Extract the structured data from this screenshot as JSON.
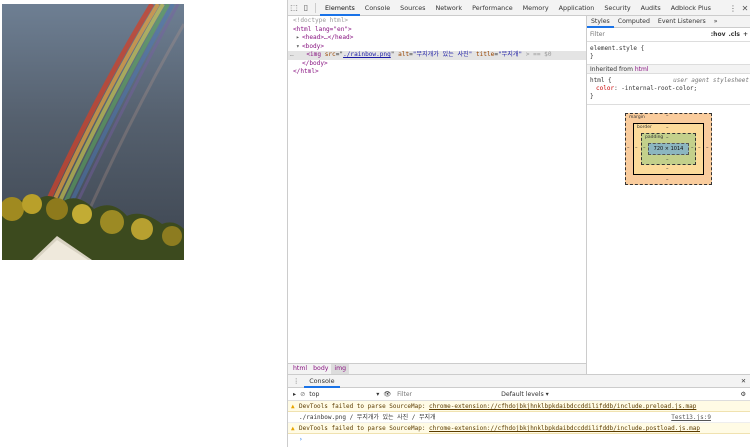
{
  "devtools": {
    "tabs": [
      "Elements",
      "Console",
      "Sources",
      "Network",
      "Performance",
      "Memory",
      "Application",
      "Security",
      "Audits",
      "Adblock Plus"
    ],
    "active_tab": "Elements"
  },
  "elements": {
    "doctype": "<!doctype html>",
    "html_open": "<html lang=\"en\">",
    "head": "<head>…</head>",
    "body_open": "<body>",
    "img_tag": "img",
    "img_src_attr": "src",
    "img_src_val": "./rainbow.png",
    "img_alt_attr": "alt",
    "img_alt_val": "\"무지개가 있는 사진\"",
    "img_title_attr": "title",
    "img_title_val": "\"무지개\"",
    "img_close": "> == $0",
    "body_close": "</body>",
    "html_close": "</html>",
    "selection_marker": "…"
  },
  "breadcrumbs": [
    "html",
    "body",
    "img"
  ],
  "styles": {
    "tabs": [
      "Styles",
      "Computed",
      "Event Listeners",
      "»"
    ],
    "filter_placeholder": "Filter",
    "hov": ":hov",
    "cls": ".cls",
    "plus": "+",
    "element_style": "element.style {",
    "close_brace": "}",
    "inherited_label": "Inherited from",
    "inherited_from": "html",
    "html_selector": "html {",
    "ua_label": "user agent stylesheet",
    "color_prop": "color",
    "color_val": "-internal-root-color;",
    "box_model": {
      "margin": "margin",
      "border": "border",
      "padding": "padding",
      "content": "720 × 1014",
      "dash": "–"
    }
  },
  "console": {
    "tab": "Console",
    "context": "top",
    "filter_placeholder": "Filter",
    "levels": "Default levels ▾",
    "messages": [
      {
        "type": "warn",
        "prefix": "DevTools failed to parse SourceMap: ",
        "link": "chrome-extension://cfhdojbkjhnklbpkdaibdccddilifddb/include.preload.js.map"
      },
      {
        "type": "plain",
        "text": "./rainbow.png / 무지개가 있는 사진 / 무지개",
        "source": "Test13.js:9"
      },
      {
        "type": "warn",
        "prefix": "DevTools failed to parse SourceMap: ",
        "link": "chrome-extension://cfhdojbkjhnklbpkdaibdccddilifddb/include.postload.js.map"
      }
    ],
    "prompt": "›"
  }
}
